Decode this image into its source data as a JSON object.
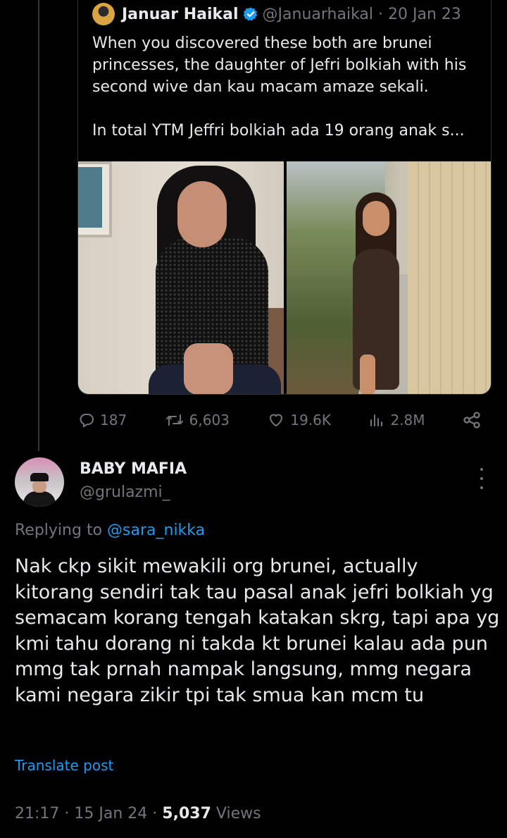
{
  "quoted_post": {
    "author_name": "Januar Haikal",
    "handle": "@Januarhaikal",
    "separator": "·",
    "date": "20 Jan 23",
    "text": "When you discovered these both are brunei princesses, the daughter of Jefri bolkiah with his second wive dan kau macam amaze sekali.\n\nIn total YTM Jeffri bolkiah ada 19 orang anak s...",
    "actions": {
      "replies": "187",
      "reposts": "6,603",
      "likes": "19.6K",
      "views": "2.8M"
    }
  },
  "reply": {
    "author_name": "BABY MAFIA",
    "handle": "@grulazmi_",
    "replying_prefix": "Replying to",
    "replying_to": "@sara_nikka",
    "text": "Nak ckp sikit mewakili org brunei, actually kitorang sendiri tak tau pasal anak jefri bolkiah yg semacam korang tengah katakan skrg, tapi apa yg kmi tahu dorang ni takda kt brunei kalau ada pun mmg tak prnah nampak langsung, mmg negara kami negara zikir tpi tak smua kan mcm tu",
    "translate_label": "Translate post",
    "time": "21:17",
    "dot1": "·",
    "date": "15 Jan 24",
    "dot2": "·",
    "views_count": "5,037",
    "views_label": "Views"
  },
  "colors": {
    "background": "#000000",
    "text": "#e7e9ea",
    "muted": "#71767b",
    "link": "#1d9bf0",
    "verified": "#1d9bf0"
  }
}
